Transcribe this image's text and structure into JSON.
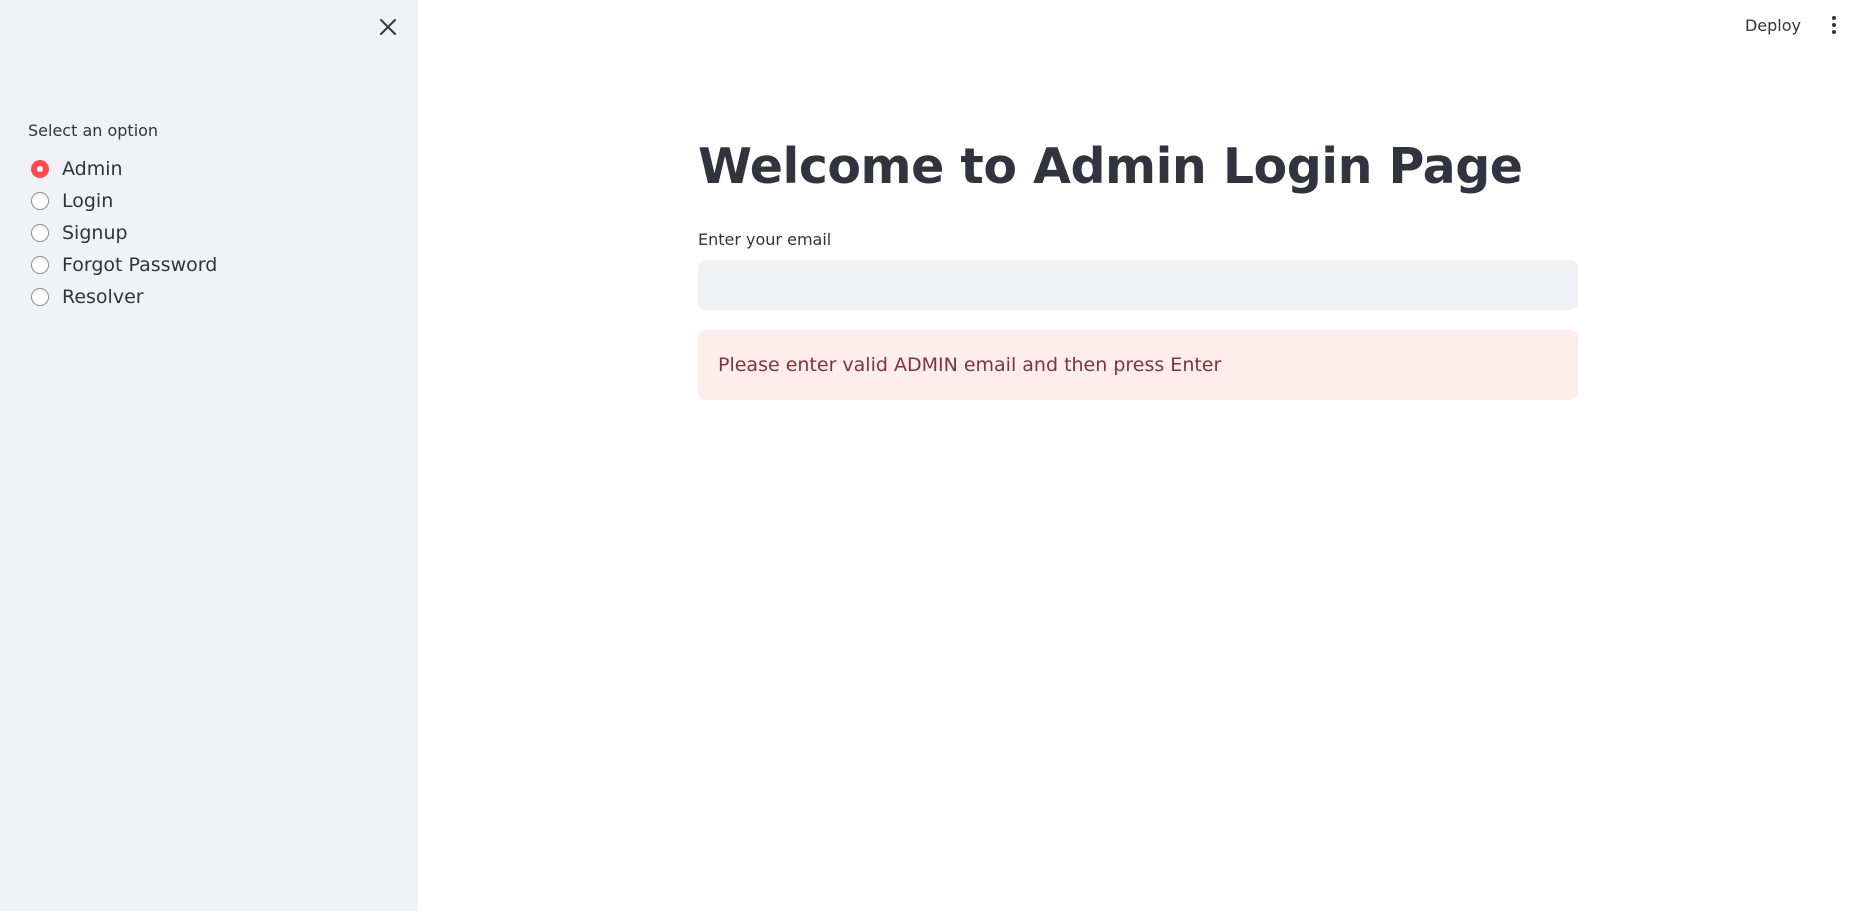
{
  "sidebar": {
    "close_icon": "close-icon",
    "radio_label": "Select an option",
    "options": [
      {
        "label": "Admin",
        "selected": true
      },
      {
        "label": "Login",
        "selected": false
      },
      {
        "label": "Signup",
        "selected": false
      },
      {
        "label": "Forgot Password",
        "selected": false
      },
      {
        "label": "Resolver",
        "selected": false
      }
    ]
  },
  "header": {
    "deploy_label": "Deploy",
    "menu_icon": "kebab-menu-icon"
  },
  "main": {
    "title": "Welcome to Admin Login Page",
    "email_label": "Enter your email",
    "email_value": "",
    "alert_text": "Please enter valid ADMIN email and then press Enter"
  },
  "colors": {
    "accent": "#ff4b4b",
    "sidebar_bg": "#f0f2f6",
    "alert_bg": "#ffecec",
    "alert_text": "#7d353b",
    "text": "#31333f"
  }
}
